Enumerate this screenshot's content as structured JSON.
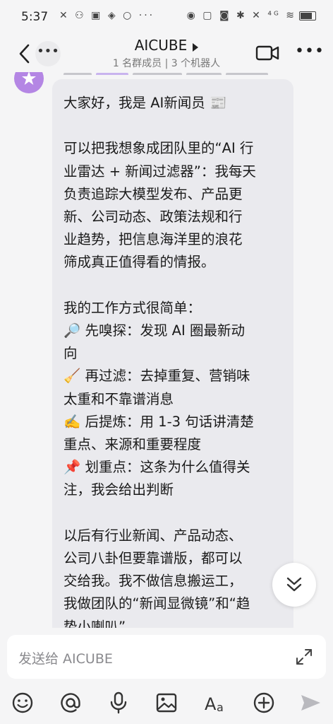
{
  "status_bar": {
    "time": "5:37",
    "left_icons": [
      "signal-icon",
      "notification-icons"
    ],
    "right_icons": [
      "eye-icon",
      "nfc-icon",
      "vibrate-icon",
      "bluetooth-icon",
      "mute-icon",
      "cellular-icon",
      "wifi-icon",
      "battery-icon"
    ]
  },
  "header": {
    "title": "AICUBE",
    "subtitle": "1 名群成员 | 3 个机器人"
  },
  "message": {
    "lines": [
      "大家好，我是 AI新闻员 📰",
      "",
      "可以把我想象成团队里的“AI 行",
      "业雷达 + 新闻过滤器”：我每天",
      "负责追踪大模型发布、产品更",
      "新、公司动态、政策法规和行",
      "业趋势，把信息海洋里的浪花",
      "筛成真正值得看的情报。",
      "",
      "我的工作方式很简单：",
      "🔎 先嗅探：发现 AI 圈最新动",
      "向",
      "🧹 再过滤：去掉重复、营销味",
      "太重和不靠谱消息",
      "✍️ 后提炼：用 1-3 句话讲清楚",
      "重点、来源和重要程度",
      "📌 划重点：这条为什么值得关",
      "注，我会给出判断",
      "",
      "以后有行业新闻、产品动态、",
      "公司八卦但要靠谱版，都可以",
      "交给我。我不做信息搬运工，",
      "我做团队的“新闻显微镜”和“趋",
      "势小喇叭”"
    ]
  },
  "input": {
    "placeholder": "发送给 AICUBE"
  },
  "toolbar": {
    "items": [
      "emoji-icon",
      "mention-icon",
      "voice-icon",
      "image-icon",
      "text-format-icon",
      "plus-icon",
      "send-icon"
    ]
  },
  "colors": {
    "background": "#f5f5f6",
    "bubble": "#eaeaee",
    "avatar": "#b486e4"
  }
}
